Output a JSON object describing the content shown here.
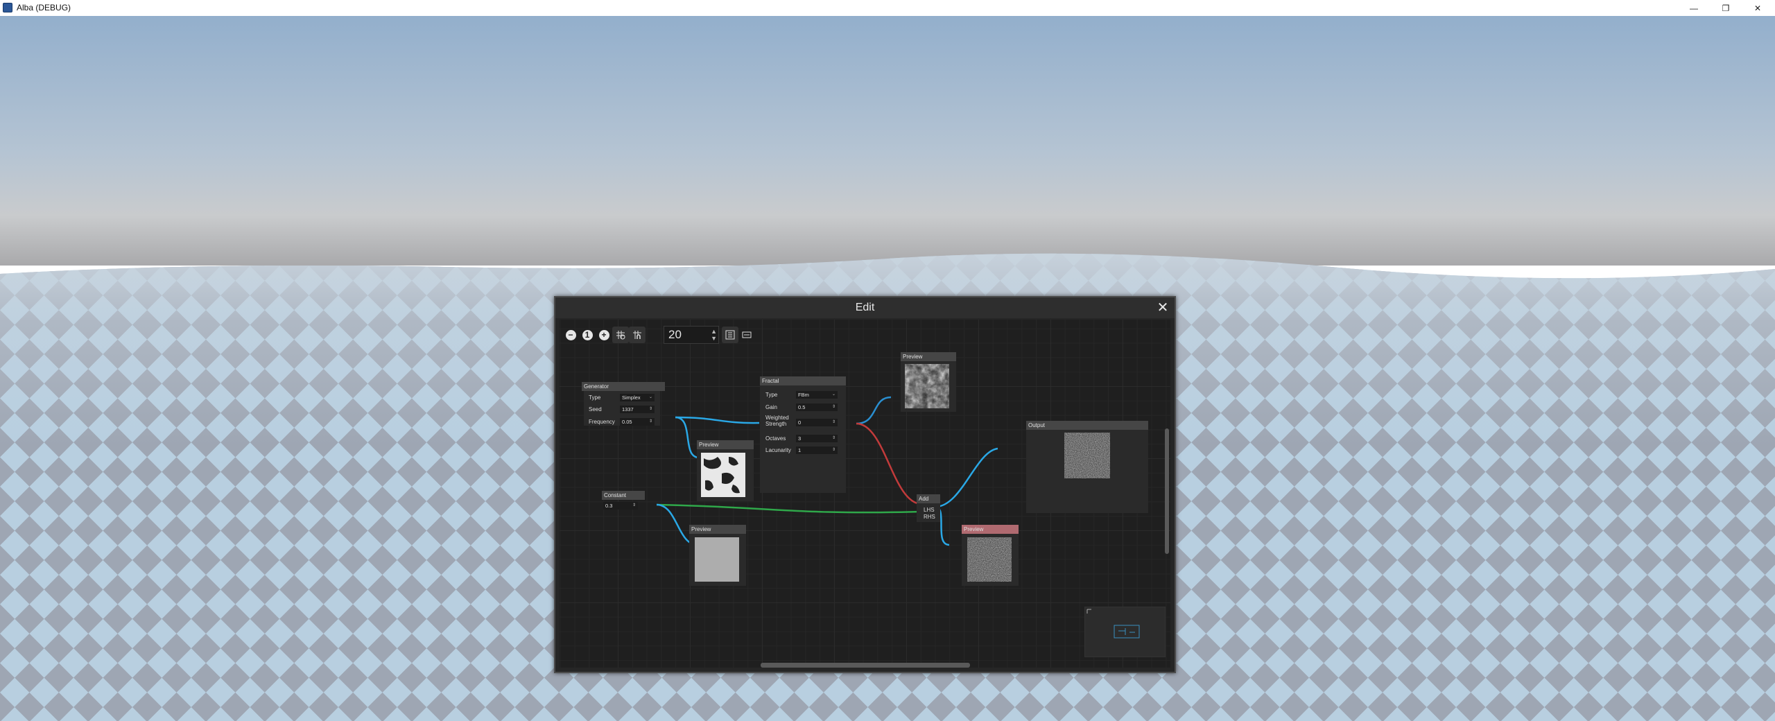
{
  "app": {
    "title": "Alba (DEBUG)"
  },
  "window_controls": {
    "minimize": "—",
    "restore": "❐",
    "close": "✕"
  },
  "edit_window": {
    "title": "Edit",
    "close_icon": "✕"
  },
  "toolbar": {
    "zoom_out": "−",
    "zoom_reset": "1",
    "zoom_in": "+",
    "snap_value": "20"
  },
  "nodes": {
    "generator": {
      "title": "Generator",
      "rows": [
        {
          "label": "Type",
          "value": "Simplex"
        },
        {
          "label": "Seed",
          "value": "1337"
        },
        {
          "label": "Frequency",
          "value": "0.05"
        }
      ]
    },
    "fractal": {
      "title": "Fractal",
      "rows": [
        {
          "label": "Type",
          "value": "FBm"
        },
        {
          "label": "Gain",
          "value": "0.5"
        },
        {
          "label": "Weighted Strength",
          "value": "0"
        },
        {
          "label": "Octaves",
          "value": "3"
        },
        {
          "label": "Lacunarity",
          "value": "1"
        }
      ]
    },
    "constant": {
      "title": "Constant",
      "value": "0.3"
    },
    "add": {
      "title": "Add",
      "lhs": "LHS",
      "rhs": "RHS"
    },
    "output": {
      "title": "Output"
    },
    "preview_top": {
      "title": "Preview"
    },
    "preview_generator": {
      "title": "Preview"
    },
    "preview_constant": {
      "title": "Preview"
    },
    "preview_add": {
      "title": "Preview"
    }
  },
  "colors": {
    "wire_blue": "#2aa8e6",
    "wire_red": "#c23b3b",
    "wire_green": "#2fa84a",
    "node_header": "#464646",
    "preview_header_selected": "#b06a70"
  }
}
